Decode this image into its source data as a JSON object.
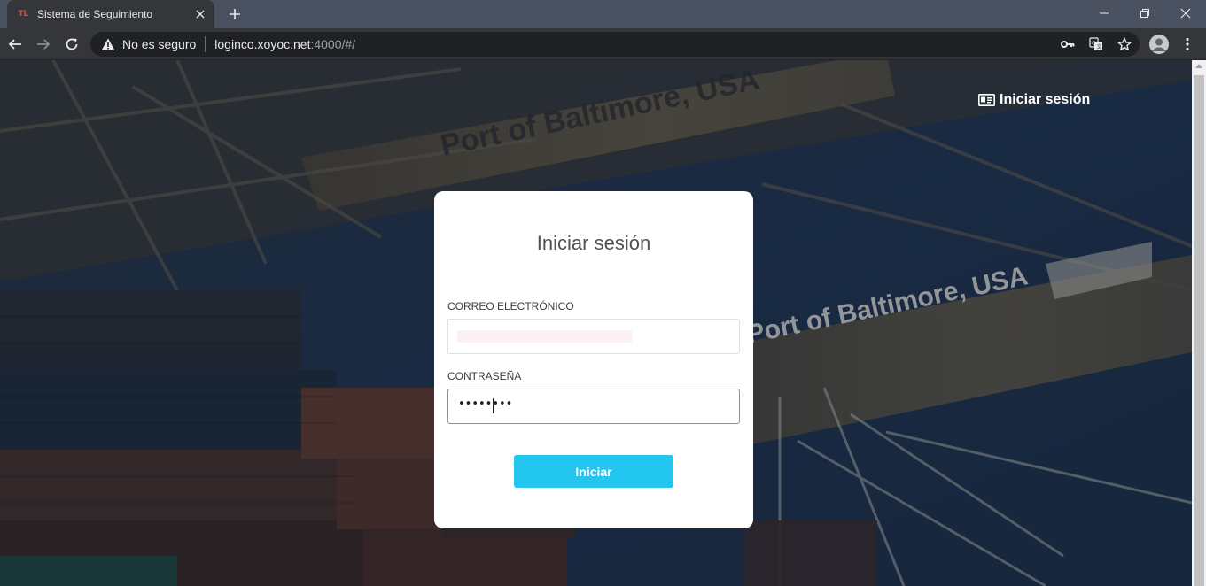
{
  "browser": {
    "tab": {
      "favicon_text": "TL",
      "title": "Sistema de Seguimiento"
    },
    "address_bar": {
      "security_text": "No es seguro",
      "url_host": "loginco.xoyoc.net",
      "url_rest": ":4000/#/"
    },
    "icons": [
      "back-icon",
      "forward-icon",
      "reload-icon",
      "warning-icon",
      "key-icon",
      "translate-icon",
      "star-icon",
      "account-icon",
      "menu-icon",
      "new-tab-icon",
      "minimize-icon",
      "restore-icon",
      "close-icon"
    ]
  },
  "page": {
    "background_signs": {
      "sign_top": "Port of Baltimore, USA",
      "sign_bottom": "Port of Baltimore, USA"
    },
    "header": {
      "login_link": "Iniciar sesión",
      "login_icon": "id-card-icon"
    },
    "login_card": {
      "title": "Iniciar sesión",
      "email_label": "CORREO ELECTRÓNICO",
      "email_value": "",
      "password_label": "CONTRASEÑA",
      "password_mask": "••••••••",
      "submit_label": "Iniciar"
    },
    "colors": {
      "accent_button": "#22c6ee",
      "tab_strip": "#4a5262",
      "toolbar": "#35363a",
      "card": "#ffffff"
    }
  }
}
